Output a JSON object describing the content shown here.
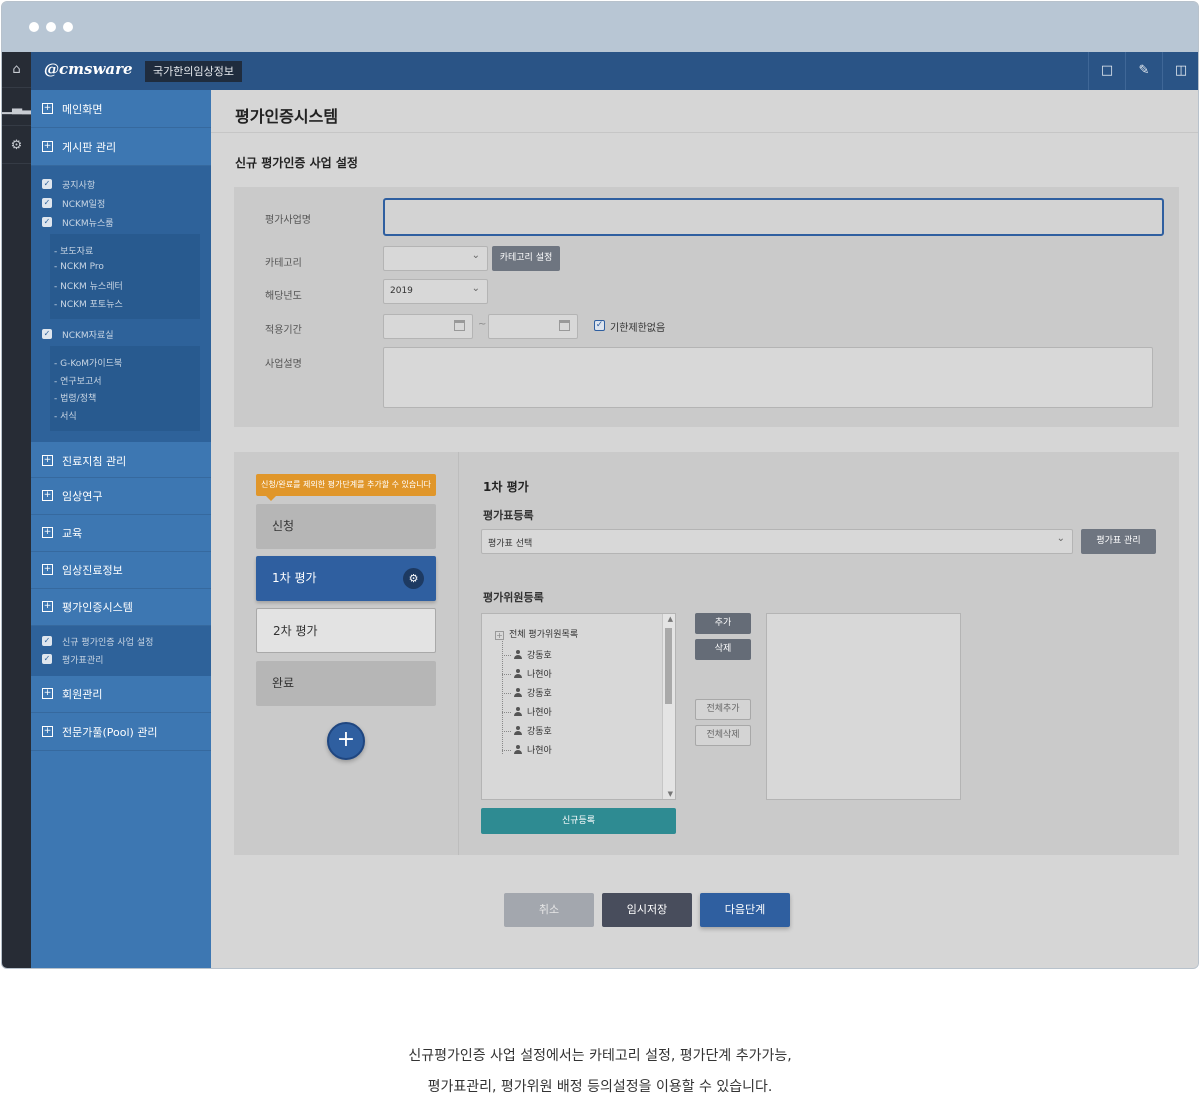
{
  "topbar": {
    "logo": "@cmsware",
    "site_name": "국가한의임상정보"
  },
  "rail_icons": [
    "home-icon",
    "chart-icon",
    "gear-icon"
  ],
  "topbar_icons": [
    "monitor-icon",
    "edit-icon",
    "briefcase-icon"
  ],
  "sidebar": {
    "main_screen": "메인화면",
    "board": "게시판 관리",
    "board_sub": [
      "공지사항",
      "NCKM일정",
      "NCKM뉴스룸"
    ],
    "newsroom_sub": [
      "- 보도자료",
      "- NCKM Pro",
      "- NCKM 뉴스레터",
      "- NCKM 포토뉴스"
    ],
    "archive": "NCKM자료실",
    "archive_sub": [
      "- G-KoM가이드북",
      "- 연구보고서",
      "- 법령/정책",
      "- 서식"
    ],
    "guideline": "진료지침 관리",
    "clinical_research": "임상연구",
    "education": "교육",
    "clinical_info": "임상진료정보",
    "eval_system": "평가인증시스템",
    "eval_sub": [
      "신규 평가인증 사업 설정",
      "평가표관리"
    ],
    "member": "회원관리",
    "expert_pool": "전문가풀(Pool) 관리"
  },
  "page": {
    "title": "평가인증시스템",
    "section": "신규 평가인증 사업 설정"
  },
  "form": {
    "name_label": "평가사업명",
    "name_value": "",
    "category_label": "카테고리",
    "category_value": "",
    "category_button": "카테고리 설정",
    "year_label": "해당년도",
    "year_value": "2019",
    "period_label": "적용기간",
    "period_start": "",
    "period_end": "",
    "period_sep": "~",
    "no_limit_label": "기한제한없음",
    "no_limit_checked": true,
    "desc_label": "사업설명",
    "desc_value": ""
  },
  "eval": {
    "tooltip": "신청/완료를 제외한 평가단계를 추가할 수 있습니다",
    "steps": [
      "신청",
      "1차 평가",
      "2차 평가",
      "완료"
    ],
    "active_step": "1차 평가",
    "heading": "1차 평가",
    "sheet_heading": "평가표등록",
    "sheet_select": "평가표 선택",
    "sheet_manage": "평가표 관리",
    "committee_heading": "평가위원등록",
    "tree_root": "전체 평가위원목록",
    "members": [
      "강동호",
      "나현아",
      "강동호",
      "나현아",
      "강동호",
      "나현아"
    ],
    "add": "추가",
    "remove": "삭제",
    "add_all": "전체추가",
    "remove_all": "전체삭제",
    "register": "신규등록"
  },
  "actions": {
    "cancel": "취소",
    "temp_save": "임시저장",
    "next": "다음단계"
  },
  "caption": [
    "신규평가인증 사업 설정에서는 카테고리 설정, 평가단계 추가가능,",
    "평가표관리, 평가위원 배정 등의설정을 이용할 수 있습니다."
  ],
  "colors": {
    "primary": "#2f5fa0",
    "sidebar": "#3d77b2",
    "topbar": "#2a5486",
    "teal": "#2e8b92",
    "tooltip": "#e0962a"
  }
}
